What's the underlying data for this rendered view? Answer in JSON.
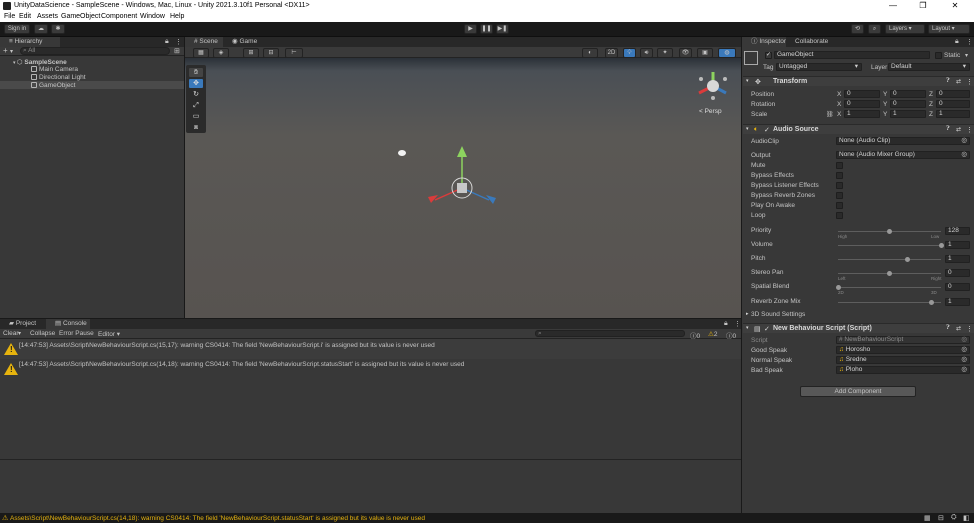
{
  "window": {
    "title": "UnityDataScience - SampleScene - Windows, Mac, Linux - Unity 2021.3.10f1 Personal <DX11>",
    "controls": [
      "—",
      "❐",
      "✕"
    ]
  },
  "menu": [
    "File",
    "Edit",
    "Assets",
    "GameObject",
    "Component",
    "Window",
    "Help"
  ],
  "toolbar": {
    "sign_in": "Sign in",
    "layers": "Layers",
    "layout": "Layout",
    "play": "▶",
    "pause": "❚❚",
    "step": "▶❚"
  },
  "hierarchy": {
    "tab": "Hierarchy",
    "add": "+",
    "search_placeholder": "All",
    "scene": "SampleScene",
    "items": [
      "Main Camera",
      "Directional Light",
      "GameObject"
    ]
  },
  "scene_view": {
    "tabs": [
      "Scene",
      "Game"
    ],
    "toggle_2d": "2D",
    "persp": "< Persp"
  },
  "inspector": {
    "tabs": [
      "Inspector",
      "Collaborate"
    ],
    "object_name": "GameObject",
    "static": "Static",
    "tag_label": "Tag",
    "tag": "Untagged",
    "layer_label": "Layer",
    "layer": "Default",
    "transform": {
      "title": "Transform",
      "rows": [
        {
          "label": "Position",
          "x": "0",
          "y": "0",
          "z": "0"
        },
        {
          "label": "Rotation",
          "x": "0",
          "y": "0",
          "z": "0"
        },
        {
          "label": "Scale",
          "x": "1",
          "y": "1",
          "z": "1"
        }
      ]
    },
    "audio": {
      "title": "Audio Source",
      "audioclip_label": "AudioClip",
      "audioclip": "None (Audio Clip)",
      "output_label": "Output",
      "output": "None (Audio Mixer Group)",
      "checks": [
        "Mute",
        "Bypass Effects",
        "Bypass Listener Effects",
        "Bypass Reverb Zones",
        "Play On Awake",
        "Loop"
      ],
      "sliders": [
        {
          "label": "Priority",
          "value": "128",
          "fraction": 0.5,
          "min_label": "High",
          "max_label": "Low"
        },
        {
          "label": "Volume",
          "value": "1",
          "fraction": 1.0,
          "min_label": "",
          "max_label": ""
        },
        {
          "label": "Pitch",
          "value": "1",
          "fraction": 0.67,
          "min_label": "",
          "max_label": ""
        },
        {
          "label": "Stereo Pan",
          "value": "0",
          "fraction": 0.5,
          "min_label": "Left",
          "max_label": "Right"
        },
        {
          "label": "Spatial Blend",
          "value": "0",
          "fraction": 0.0,
          "min_label": "2D",
          "max_label": "3D"
        },
        {
          "label": "Reverb Zone Mix",
          "value": "1",
          "fraction": 0.91,
          "min_label": "",
          "max_label": ""
        }
      ],
      "sound_settings": "3D Sound Settings"
    },
    "script": {
      "title": "New Behaviour Script (Script)",
      "script_label": "Script",
      "script": "NewBehaviourScript",
      "fields": [
        {
          "label": "Good Speak",
          "value": "Horosho"
        },
        {
          "label": "Normal Speak",
          "value": "Sredne"
        },
        {
          "label": "Bad Speak",
          "value": "Ploho"
        }
      ]
    },
    "add_component": "Add Component"
  },
  "console": {
    "tabs": [
      "Project",
      "Console"
    ],
    "clear": "Clear",
    "collapse": "Collapse",
    "error_pause": "Error Pause",
    "editor": "Editor",
    "count_errors": "0",
    "count_warnings": "2",
    "count_info": "0",
    "messages": [
      "[14:47:53] Assets\\Script\\NewBehaviourScript.cs(15,17): warning CS0414: The field 'NewBehaviourScript.i' is assigned but its value is never used",
      "[14:47:53] Assets\\Script\\NewBehaviourScript.cs(14,18): warning CS0414: The field 'NewBehaviourScript.statusStart' is assigned but its value is never used"
    ]
  },
  "status": "Assets\\Script\\NewBehaviourScript.cs(14,18): warning CS0414: The field 'NewBehaviourScript.statusStart' is assigned but its value is never used",
  "colors": {
    "warning": "#e7b40e",
    "status_text": "#e7b40e",
    "accent": "#3a79bb"
  }
}
